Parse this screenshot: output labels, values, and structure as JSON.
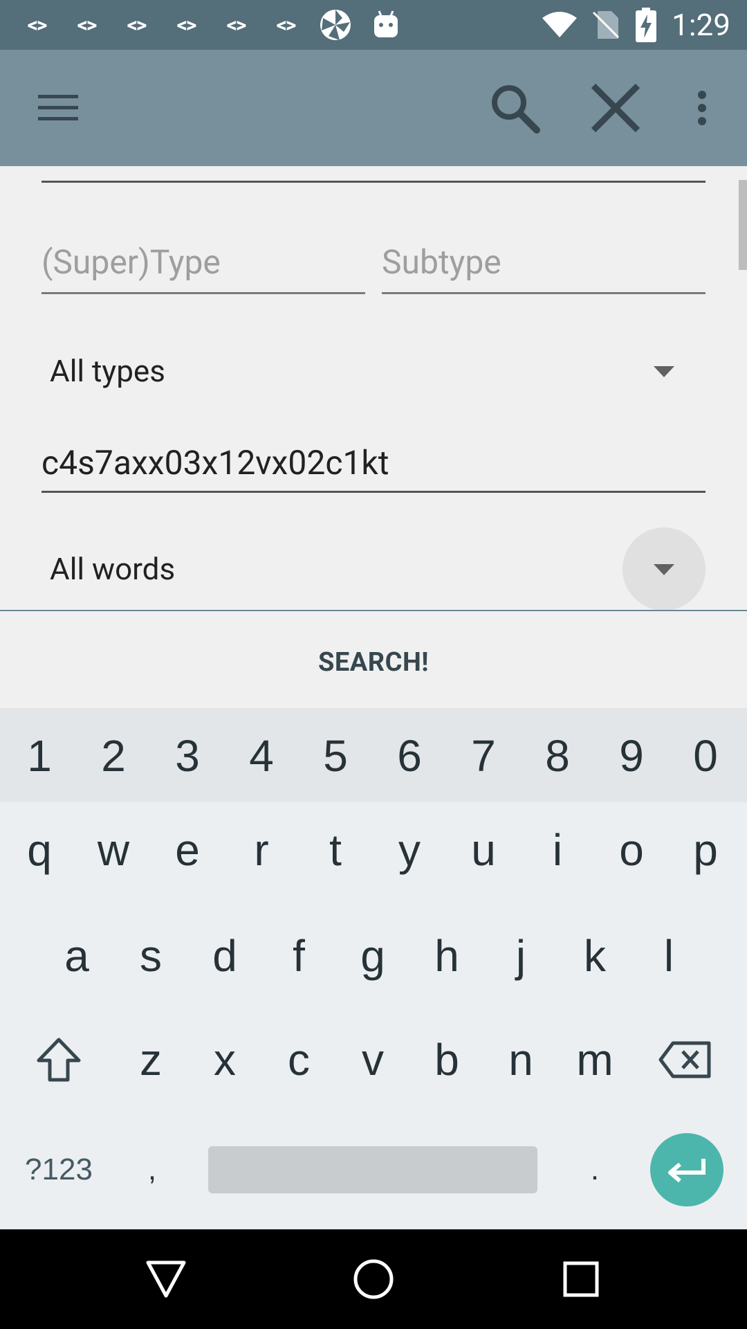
{
  "status_bar": {
    "notification_icons": [
      "<>",
      "<>",
      "<>",
      "<>",
      "<>",
      "<>"
    ],
    "extra_icons": [
      "pinwheel-icon",
      "android-icon"
    ],
    "time": "1:29",
    "system_icons": [
      "wifi-icon",
      "no-sim-icon",
      "battery-charging-icon"
    ]
  },
  "app_bar": {
    "menu_icon": "menu-icon",
    "search_icon": "search-icon",
    "close_icon": "close-icon",
    "overflow_icon": "more-vert-icon"
  },
  "form": {
    "supertype_placeholder": "(Super)Type",
    "subtype_placeholder": "Subtype",
    "types_spinner": "All types",
    "text_value": "c4s7axx03x12vx02c1kt",
    "words_spinner": "All words"
  },
  "search_button": "SEARCH!",
  "keyboard": {
    "number_row": [
      "1",
      "2",
      "3",
      "4",
      "5",
      "6",
      "7",
      "8",
      "9",
      "0"
    ],
    "row1": [
      "q",
      "w",
      "e",
      "r",
      "t",
      "y",
      "u",
      "i",
      "o",
      "p"
    ],
    "row2": [
      "a",
      "s",
      "d",
      "f",
      "g",
      "h",
      "j",
      "k",
      "l"
    ],
    "row3": [
      "z",
      "x",
      "c",
      "v",
      "b",
      "n",
      "m"
    ],
    "symbols_key": "?123",
    "comma_key": ",",
    "period_key": ".",
    "accent_color": "#4db6ac"
  },
  "nav_bar": {
    "back_icon": "back-triangle-icon",
    "home_icon": "home-circle-icon",
    "recents_icon": "recents-square-icon"
  }
}
